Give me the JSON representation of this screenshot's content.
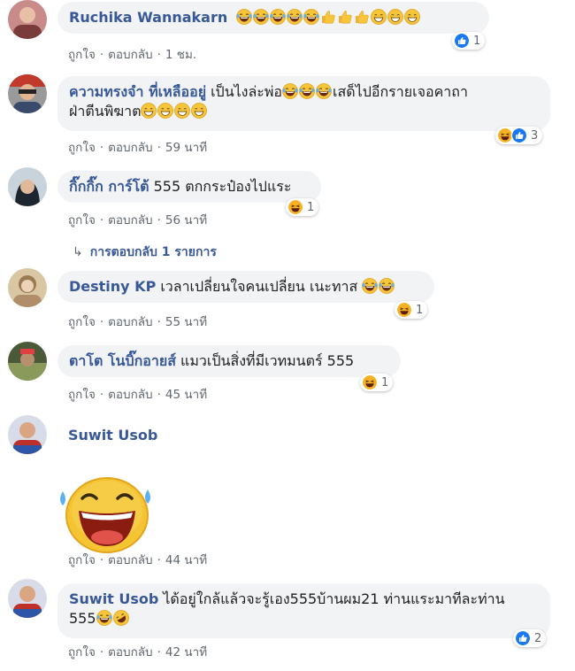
{
  "comments": [
    {
      "name": "Ruchika Wannakarn",
      "text": "",
      "like": "ถูกใจ",
      "reply": "ตอบกลับ",
      "time": "1 ชม.",
      "reactions": "1",
      "avatar_color": "#c98a8a"
    },
    {
      "name": "ความทรงจำ ที่เหลืออยู่",
      "text": "เป็นไงล่ะพ่อ",
      "text2": "เสด็ไปอีกรายเจอคาถา",
      "line2": "ฝ่าตีนพิฆาต",
      "like": "ถูกใจ",
      "reply": "ตอบกลับ",
      "time": "59 นาที",
      "reactions": "3",
      "avatar_color": "#8a8a8a"
    },
    {
      "name": "กิ๊กกิ๊ก การ์โต้",
      "text": "555 ตกกระป๋องไปแระ",
      "like": "ถูกใจ",
      "reply": "ตอบกลับ",
      "time": "56 นาที",
      "reactions": "1",
      "avatar_color": "#5b6a7a"
    },
    {
      "name": "Destiny KP",
      "text": "เวลาเปลี่ยนใจคนเปลี่ยน เนะทาส",
      "like": "ถูกใจ",
      "reply": "ตอบกลับ",
      "time": "55 นาที",
      "reactions": "1",
      "avatar_color": "#b9a07c"
    },
    {
      "name": "ตาโต โนบิ๊กอายส์",
      "text": "แมวเป็นสิ่งที่มีเวทมนตร์ 555",
      "like": "ถูกใจ",
      "reply": "ตอบกลับ",
      "time": "45 นาที",
      "reactions": "1",
      "avatar_color": "#6b7a4a"
    },
    {
      "name": "Suwit Usob",
      "text": "",
      "like": "ถูกใจ",
      "reply": "ตอบกลับ",
      "time": "44 นาที",
      "avatar_color": "#2d55a8"
    },
    {
      "name": "Suwit Usob",
      "text": "ได้อยู่ใกล้แล้วจะรู้เอง555บ้านผม21 ท่านแระมาทีละท่าน",
      "line2": "555",
      "like": "ถูกใจ",
      "reply": "ตอบกลับ",
      "time": "42 นาที",
      "reactions": "2",
      "avatar_color": "#2d55a8"
    }
  ],
  "replies_link": "การตอบกลับ 1 รายการ",
  "colors": {
    "name": "#385898",
    "bubble": "#f2f3f5",
    "meta": "#606770",
    "like_blue": "#1877f2",
    "haha_yellow": "#f7b125"
  }
}
